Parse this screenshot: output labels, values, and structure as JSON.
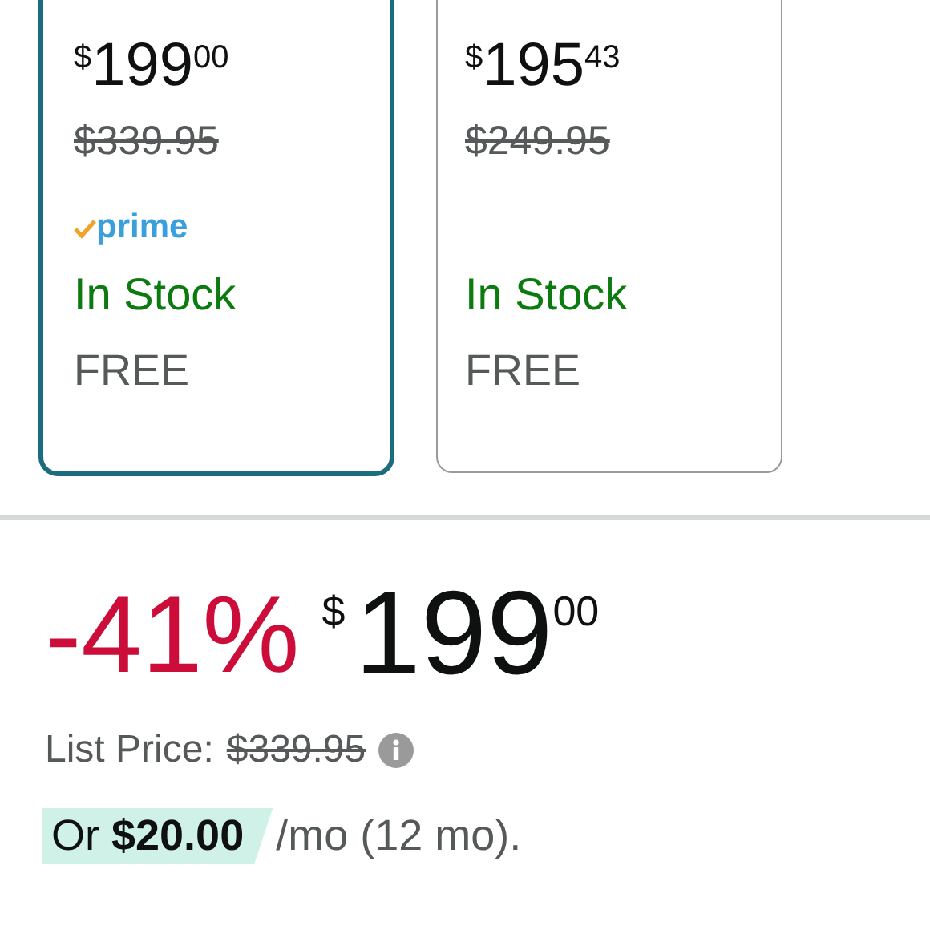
{
  "offers": [
    {
      "selected": true,
      "price": {
        "symbol": "$",
        "whole": "199",
        "fraction": "00"
      },
      "was_price": "$339.95",
      "prime": {
        "label": "prime"
      },
      "stock": "In Stock",
      "delivery": "FREE"
    },
    {
      "selected": false,
      "price": {
        "symbol": "$",
        "whole": "195",
        "fraction": "43"
      },
      "was_price": "$249.95",
      "stock": "In Stock",
      "delivery": "FREE"
    }
  ],
  "buy_box": {
    "discount": "-41%",
    "price": {
      "symbol": "$",
      "whole": "199",
      "fraction": "00"
    },
    "list_price_label": "List Price:",
    "list_price": "$339.95",
    "monthly_highlight": "Or **$20.00**",
    "monthly_rest": "/mo (12 mo)."
  }
}
